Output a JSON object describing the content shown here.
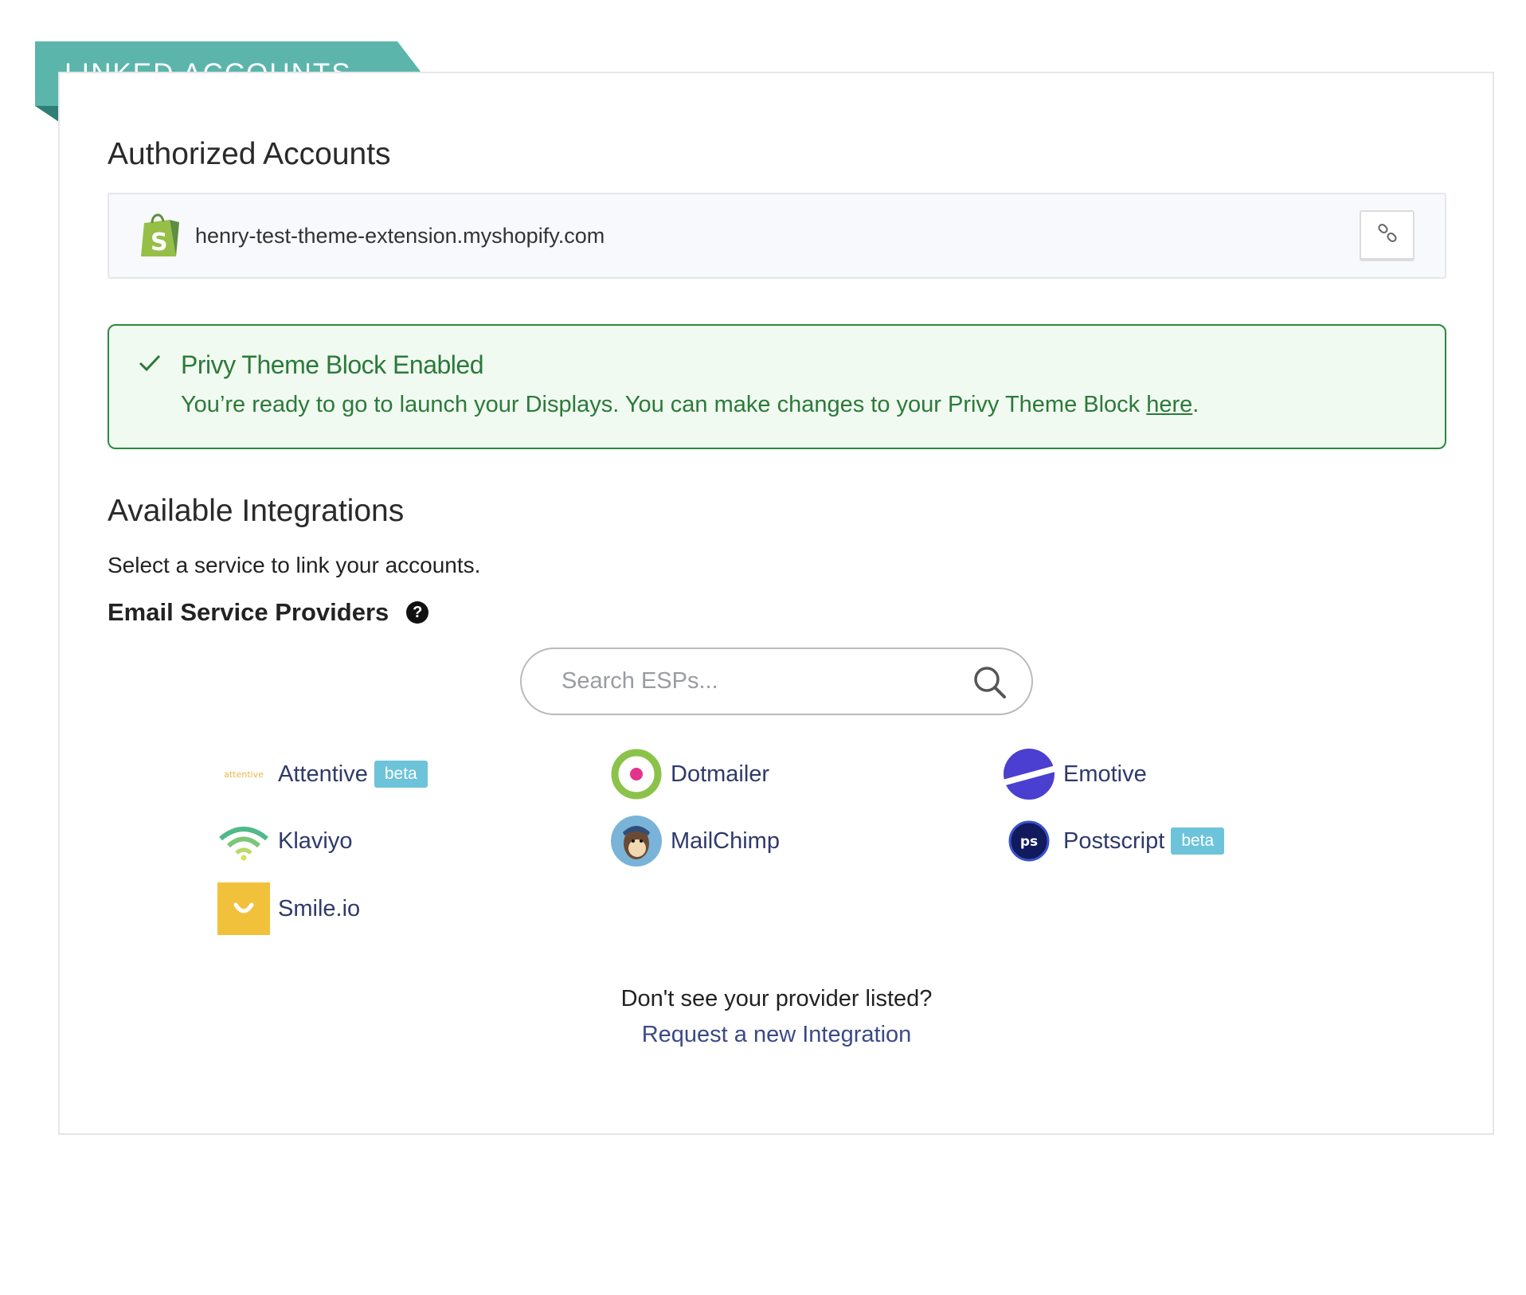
{
  "ribbon": {
    "label": "LINKED ACCOUNTS"
  },
  "authorized": {
    "title": "Authorized Accounts",
    "account": "henry-test-theme-extension.myshopify.com"
  },
  "alert": {
    "title": "Privy Theme Block Enabled",
    "body": "You’re ready to go to launch your Displays. You can make changes to your Privy Theme Block ",
    "link": "here",
    "end": "."
  },
  "available": {
    "title": "Available Integrations",
    "subtitle": "Select a service to link your accounts.",
    "esp_title": "Email Service Providers",
    "help": "?"
  },
  "search": {
    "placeholder": "Search ESPs..."
  },
  "integrations": {
    "attentive": {
      "name": "Attentive",
      "logo_text": "attentive",
      "badge": "beta"
    },
    "dotmailer": {
      "name": "Dotmailer"
    },
    "emotive": {
      "name": "Emotive"
    },
    "klaviyo": {
      "name": "Klaviyo"
    },
    "mailchimp": {
      "name": "MailChimp"
    },
    "postscript": {
      "name": "Postscript",
      "logo_text": "ps",
      "badge": "beta"
    },
    "smile": {
      "name": "Smile.io"
    }
  },
  "footer": {
    "question": "Don't see your provider listed?",
    "link": "Request a new Integration"
  },
  "colors": {
    "ribbon": "#5bb5ab",
    "success": "#2b7a3a",
    "link": "#3a4a86",
    "badge": "#6cc3da"
  }
}
